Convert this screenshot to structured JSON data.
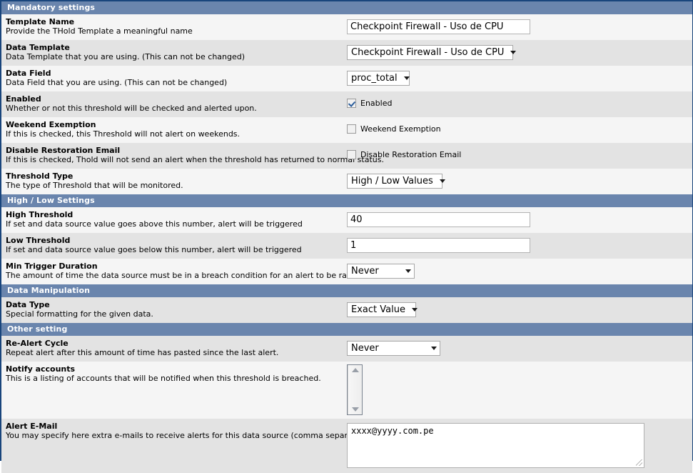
{
  "sections": {
    "mandatory": "Mandatory settings",
    "highlow": "High / Low Settings",
    "manipulation": "Data Manipulation",
    "other": "Other setting"
  },
  "fields": {
    "template_name": {
      "title": "Template Name",
      "desc": "Provide the THold Template a meaningful name",
      "value": "Checkpoint Firewall - Uso de CPU"
    },
    "data_template": {
      "title": "Data Template",
      "desc": "Data Template that you are using. (This can not be changed)",
      "value": "Checkpoint Firewall - Uso de CPU"
    },
    "data_field": {
      "title": "Data Field",
      "desc": "Data Field that you are using. (This can not be changed)",
      "value": "proc_total"
    },
    "enabled": {
      "title": "Enabled",
      "desc": "Whether or not this threshold will be checked and alerted upon.",
      "checkbox_label": "Enabled",
      "checked": true
    },
    "weekend_exemption": {
      "title": "Weekend Exemption",
      "desc": "If this is checked, this Threshold will not alert on weekends.",
      "checkbox_label": "Weekend Exemption",
      "checked": false
    },
    "disable_restoration_email": {
      "title": "Disable Restoration Email",
      "desc": "If this is checked, Thold will not send an alert when the threshold has returned to normal status.",
      "checkbox_label": "Disable Restoration Email",
      "checked": false
    },
    "threshold_type": {
      "title": "Threshold Type",
      "desc": "The type of Threshold that will be monitored.",
      "value": "High / Low Values"
    },
    "high_threshold": {
      "title": "High Threshold",
      "desc": "If set and data source value goes above this number, alert will be triggered",
      "value": "40"
    },
    "low_threshold": {
      "title": "Low Threshold",
      "desc": "If set and data source value goes below this number, alert will be triggered",
      "value": "1"
    },
    "min_trigger_duration": {
      "title": "Min Trigger Duration",
      "desc": "The amount of time the data source must be in a breach condition for an alert to be raised.",
      "value": "Never"
    },
    "data_type": {
      "title": "Data Type",
      "desc": "Special formatting for the given data.",
      "value": "Exact Value"
    },
    "re_alert_cycle": {
      "title": "Re-Alert Cycle",
      "desc": "Repeat alert after this amount of time has pasted since the last alert.",
      "value": "Never"
    },
    "notify_accounts": {
      "title": "Notify accounts",
      "desc": "This is a listing of accounts that will be notified when this threshold is breached.",
      "value": ""
    },
    "alert_email": {
      "title": "Alert E-Mail",
      "desc": "You may specify here extra e-mails to receive alerts for this data source (comma separated)",
      "value": "xxxx@yyyy.com.pe"
    }
  },
  "colors": {
    "section_header_bg": "#6a85ad",
    "page_border": "#19457c",
    "row_light": "#f5f5f5",
    "row_dark": "#e3e3e3",
    "checkbox_check": "#2b5d9b"
  }
}
